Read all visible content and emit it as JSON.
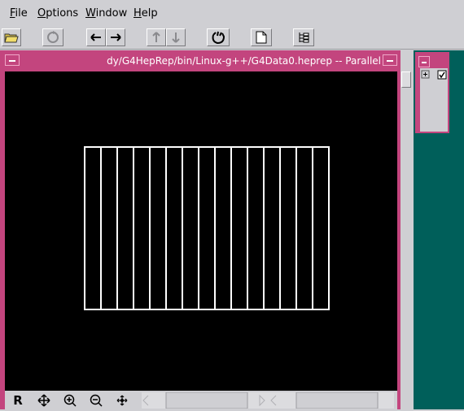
{
  "menu": {
    "file": "File",
    "options": "Options",
    "window": "Window",
    "help": "Help"
  },
  "toolbar": {
    "buttons": [
      "open-folder-icon",
      "reload-icon",
      "back-icon",
      "forward-icon",
      "up-icon",
      "down-icon",
      "hand-icon",
      "new-page-icon",
      "tree-icon"
    ]
  },
  "frame": {
    "title": "dy/G4HepRep/bin/Linux-g++/G4Data0.heprep -- Parallel",
    "vertical_lines": 14
  },
  "navigation": {
    "r_label": "R"
  },
  "colors": {
    "frame_title": "#c3457e",
    "canvas": "#000000",
    "side_panel": "#005f5a"
  }
}
